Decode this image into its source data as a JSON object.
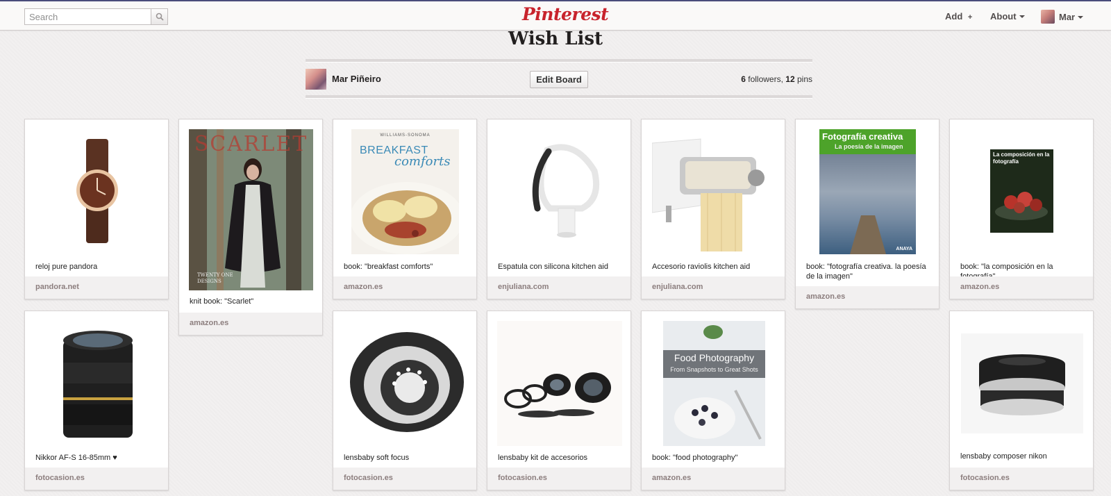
{
  "header": {
    "search_placeholder": "Search",
    "logo": "Pinterest",
    "nav": {
      "add": "Add",
      "add_glyph": "+",
      "about": "About",
      "user": "Mar"
    }
  },
  "board": {
    "title": "Wish List",
    "owner": "Mar Piñeiro",
    "edit_label": "Edit Board",
    "followers": "6",
    "followers_label": "followers,",
    "pins": "12",
    "pins_label": "pins"
  },
  "pins": [
    {
      "desc": "reloj pure pandora",
      "source": "pandora.net"
    },
    {
      "desc": "knit book: \"Scarlet\"",
      "source": "amazon.es"
    },
    {
      "desc": "book: \"breakfast comforts\"",
      "source": "amazon.es"
    },
    {
      "desc": "Espatula con silicona kitchen aid",
      "source": "enjuliana.com"
    },
    {
      "desc": "Accesorio raviolis kitchen aid",
      "source": "enjuliana.com"
    },
    {
      "desc": "book: \"fotografía creativa. la poesía de la imagen\"",
      "source": "amazon.es"
    },
    {
      "desc": "book: \"la composición en la fotografía\"",
      "source": "amazon.es"
    },
    {
      "desc": "Nikkor AF-S 16-85mm ♥",
      "source": "fotocasion.es"
    },
    {
      "desc": "lensbaby soft focus",
      "source": "fotocasion.es"
    },
    {
      "desc": "lensbaby kit de accesorios",
      "source": "fotocasion.es"
    },
    {
      "desc": "book: \"food photography\"",
      "source": "amazon.es"
    },
    {
      "desc": "lensbaby composer nikon",
      "source": "fotocasion.es"
    }
  ],
  "covers": {
    "scarlet": "SCARLET",
    "scarlet_sub": "TWENTY ONE DESIGNS",
    "breakfast_brand": "WILLIAMS-SONOMA",
    "breakfast_1": "BREAKFAST",
    "breakfast_2": "comforts",
    "foto_title": "Fotografía creativa",
    "foto_sub": "La poesía de la imagen",
    "foto_publisher": "ANAYA",
    "comp_title": "La composición en la fotografía",
    "food_title": "Food Photography",
    "food_sub": "From Snapshots to Great Shots"
  },
  "colors": {
    "brand_red": "#c8232c",
    "topbar_accent": "#494c7a",
    "source_text": "#8c7e7e"
  },
  "icons": {
    "search": "magnifier-icon",
    "caret": "chevron-down-icon"
  }
}
